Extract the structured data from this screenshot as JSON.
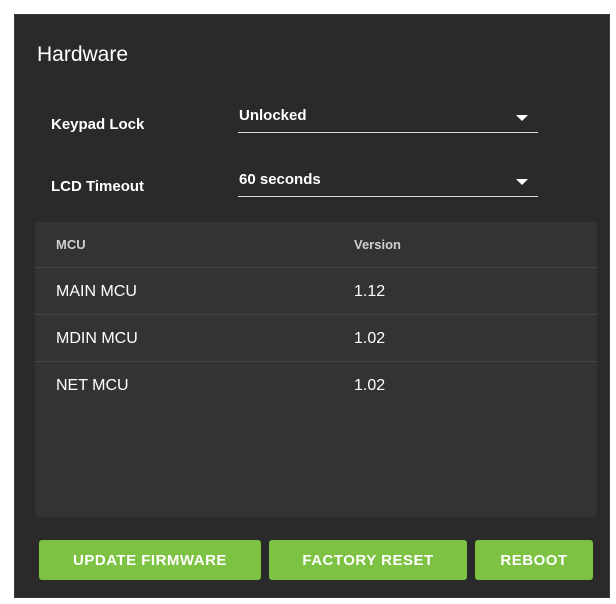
{
  "panel": {
    "title": "Hardware"
  },
  "settings": {
    "keypad_lock": {
      "label": "Keypad Lock",
      "value": "Unlocked"
    },
    "lcd_timeout": {
      "label": "LCD Timeout",
      "value": "60 seconds"
    }
  },
  "mcu_table": {
    "headers": {
      "mcu": "MCU",
      "version": "Version"
    },
    "rows": [
      {
        "mcu": "MAIN MCU",
        "version": "1.12"
      },
      {
        "mcu": "MDIN MCU",
        "version": "1.02"
      },
      {
        "mcu": "NET MCU",
        "version": "1.02"
      }
    ]
  },
  "actions": {
    "update_firmware": "UPDATE FIRMWARE",
    "factory_reset": "FACTORY RESET",
    "reboot": "REBOOT"
  },
  "colors": {
    "panel_bg": "#2a2a2a",
    "table_bg": "#333333",
    "accent_green": "#7dc242",
    "text": "#ffffff"
  },
  "icons": {
    "dropdown": "caret-down-icon"
  }
}
